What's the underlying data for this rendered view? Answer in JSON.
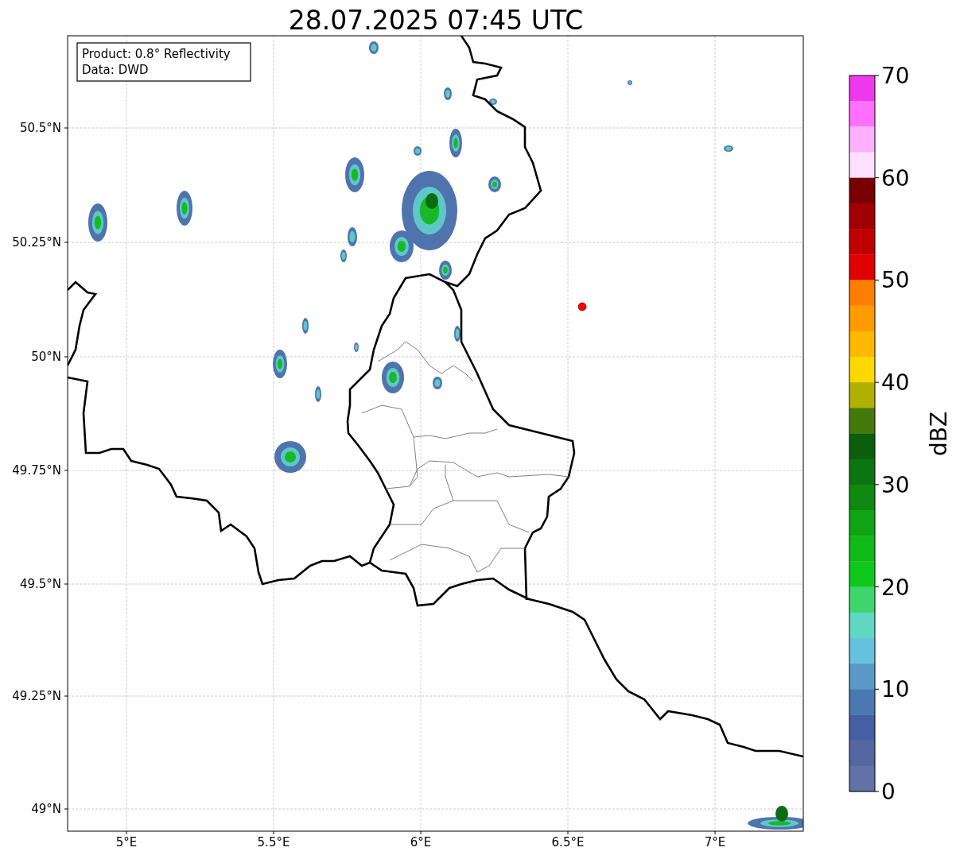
{
  "title": "28.07.2025 07:45 UTC",
  "legend": {
    "lines": [
      "Product: 0.8° Reflectivity",
      "Data: DWD"
    ]
  },
  "map": {
    "x_tick_labels": [
      "5°E",
      "5.5°E",
      "6°E",
      "6.5°E",
      "7°E"
    ],
    "y_tick_labels": [
      "50.5°N",
      "50.25°N",
      "50°N",
      "49.75°N",
      "49.5°N",
      "49.25°N",
      "49°N"
    ]
  },
  "colorbar": {
    "label": "dBZ",
    "tick_labels": [
      "70",
      "60",
      "50",
      "40",
      "30",
      "20",
      "10",
      "0"
    ],
    "bands": [
      {
        "color": "#ee38ee"
      },
      {
        "color": "#ff70ff"
      },
      {
        "color": "#ffb0ff"
      },
      {
        "color": "#ffe0ff"
      },
      {
        "color": "#780000"
      },
      {
        "color": "#a00000"
      },
      {
        "color": "#c00000"
      },
      {
        "color": "#e00000"
      },
      {
        "color": "#ff7e00"
      },
      {
        "color": "#ff9a00"
      },
      {
        "color": "#ffb800"
      },
      {
        "color": "#ffd800"
      },
      {
        "color": "#b0b000"
      },
      {
        "color": "#457a0a"
      },
      {
        "color": "#0a5e0c"
      },
      {
        "color": "#0c7410"
      },
      {
        "color": "#0e8a10"
      },
      {
        "color": "#10a414"
      },
      {
        "color": "#10b818"
      },
      {
        "color": "#10c81c"
      },
      {
        "color": "#3ed66c"
      },
      {
        "color": "#60d8c0"
      },
      {
        "color": "#66c2dc"
      },
      {
        "color": "#5a9ac6"
      },
      {
        "color": "#4a78b0"
      },
      {
        "color": "#4460a2"
      },
      {
        "color": "#5366a0"
      },
      {
        "color": "#6272a6"
      }
    ]
  }
}
